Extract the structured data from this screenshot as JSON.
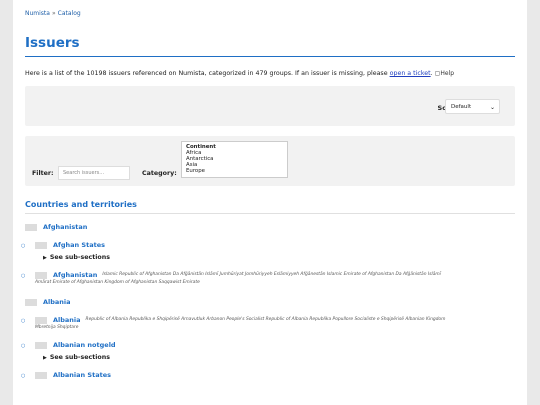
{
  "breadcrumb": {
    "home": "Numista",
    "sep": "»",
    "current": "Catalog"
  },
  "page_title": "Issuers",
  "intro": {
    "text_before": "Here is a list of the 10198 issuers referenced on Numista, categorized in 479 groups. If an issuer is missing, please ",
    "link": "open a ticket",
    "text_after": ".",
    "help": "Help"
  },
  "sort": {
    "label": "Sort",
    "value": "Default"
  },
  "filter": {
    "label": "Filter:",
    "placeholder": "Search issuers..."
  },
  "category": {
    "label": "Category:",
    "options": [
      "Continent",
      "Africa",
      "Antarctica",
      "Asia",
      "Europe"
    ]
  },
  "section_title": "Countries and territories",
  "groups": [
    {
      "name": "Afghanistan",
      "issuers": [
        {
          "name": "Afghan States",
          "sub": "See sub-sections"
        },
        {
          "name": "Afghanistan",
          "alt_line1": "Islamic Republic of Afghanistan Da Afğānistān Islāmī Jumhūriyat Jomhūriyyeh Eslāmiyyeh Afğānestān Islamic Emirate of Afghanistan Da Afğānistān Islāmī",
          "alt_line2": "Amārat Emirate of Afghanistan Kingdom of Afghanistan Saqqawist Emirate"
        }
      ]
    },
    {
      "name": "Albania",
      "issuers": [
        {
          "name": "Albania",
          "alt_line1": "Republic of Albania Republika e Shqipërisë Arnavutluk Arbanon People's Socialist Republic of Albania Republika Popullore Socialiste e Shqipërisë Albanian Kingdom",
          "alt_line2": "Mbretnija Shqiptare"
        },
        {
          "name": "Albanian notgeld",
          "sub": "See sub-sections"
        },
        {
          "name": "Albanian States"
        }
      ]
    }
  ],
  "colors": {
    "accent": "#1f6fc5",
    "link": "#1f3fbf"
  }
}
